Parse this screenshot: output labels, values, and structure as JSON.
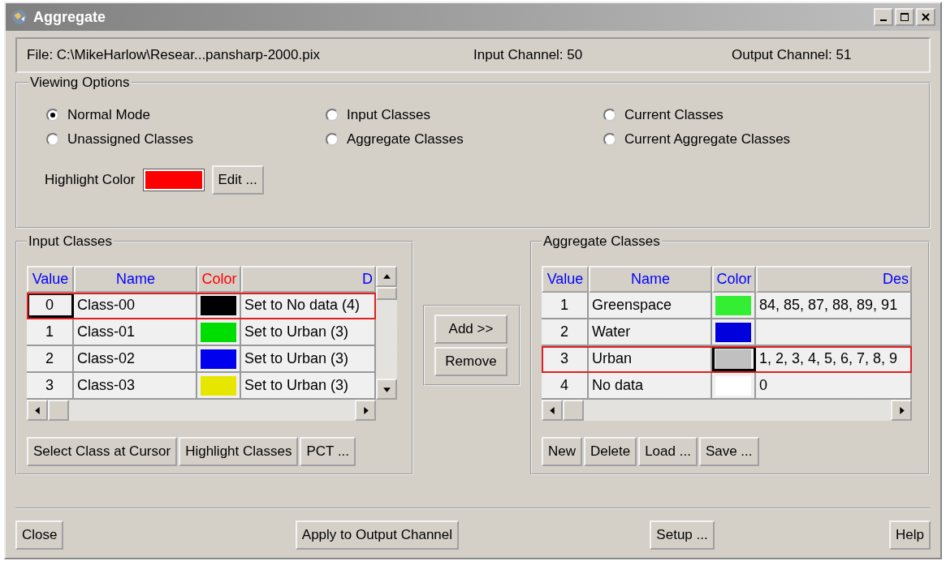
{
  "window": {
    "title": "Aggregate"
  },
  "info": {
    "file": "File: C:\\MikeHarlow\\Resear...pansharp-2000.pix",
    "input_channel": "Input Channel: 50",
    "output_channel": "Output Channel: 51"
  },
  "viewing_options": {
    "title": "Viewing Options",
    "modes": [
      {
        "label": "Normal Mode",
        "selected": true
      },
      {
        "label": "Input Classes",
        "selected": false
      },
      {
        "label": "Current Classes",
        "selected": false
      },
      {
        "label": "Unassigned Classes",
        "selected": false
      },
      {
        "label": "Aggregate Classes",
        "selected": false
      },
      {
        "label": "Current Aggregate Classes",
        "selected": false
      }
    ],
    "highlight": {
      "label": "Highlight Color",
      "color": "#ff0000"
    },
    "edit_button": "Edit ..."
  },
  "input_classes": {
    "title": "Input Classes",
    "columns": [
      {
        "label": "Value",
        "color": "#0000ff"
      },
      {
        "label": "Name",
        "color": "#0000ff"
      },
      {
        "label": "Color",
        "color": "#ff0000"
      },
      {
        "label": "D",
        "color": "#0000ff"
      }
    ],
    "rows": [
      {
        "value": "0",
        "name": "Class-00",
        "color": "#000000",
        "description": "Set to No data (4)",
        "selected": true,
        "value_focused": true
      },
      {
        "value": "1",
        "name": "Class-01",
        "color": "#00dd00",
        "description": "Set to Urban (3)",
        "selected": false
      },
      {
        "value": "2",
        "name": "Class-02",
        "color": "#0000ee",
        "description": "Set to Urban (3)",
        "selected": false
      },
      {
        "value": "3",
        "name": "Class-03",
        "color": "#e6e600",
        "description": "Set to Urban (3)",
        "selected": false
      }
    ],
    "buttons": [
      "Select Class at Cursor",
      "Highlight Classes",
      "PCT ..."
    ]
  },
  "transfer_buttons": [
    "Add >>",
    "Remove"
  ],
  "aggregate_classes": {
    "title": "Aggregate Classes",
    "columns": [
      {
        "label": "Value",
        "color": "#0000ff"
      },
      {
        "label": "Name",
        "color": "#0000ff"
      },
      {
        "label": "Color",
        "color": "#0000ff"
      },
      {
        "label": "Des",
        "color": "#0000ff"
      }
    ],
    "rows": [
      {
        "value": "1",
        "name": "Greenspace",
        "color": "#33ee33",
        "description": "84, 85, 87, 88, 89, 91",
        "selected": false
      },
      {
        "value": "2",
        "name": "Water",
        "color": "#0000dd",
        "selected": false
      },
      {
        "value": "3",
        "name": "Urban",
        "color": "#c0c0c0",
        "description": "1, 2, 3, 4, 5, 6, 7, 8, 9",
        "selected": true,
        "color_focused": true
      },
      {
        "value": "4",
        "name": "No data",
        "color": "#ffffff",
        "description": "0",
        "selected": false
      }
    ],
    "buttons": [
      "New",
      "Delete",
      "Load ...",
      "Save ..."
    ]
  },
  "bottom_buttons": [
    "Close",
    "Apply to Output Channel",
    "Setup ...",
    "Help"
  ]
}
